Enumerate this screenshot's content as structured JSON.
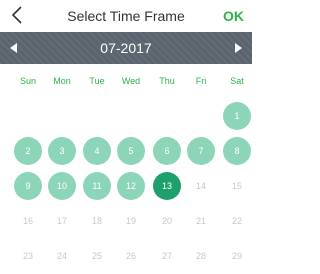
{
  "header": {
    "back_icon": "chevron-left-icon",
    "title": "Select Time Frame",
    "ok_label": "OK",
    "ok_color": "#2db34a"
  },
  "month_bar": {
    "label": "07-2017",
    "prev_icon": "triangle-left-icon",
    "next_icon": "triangle-right-icon",
    "background": "#5b646e"
  },
  "weekdays": [
    "Sun",
    "Mon",
    "Tue",
    "Wed",
    "Thu",
    "Fri",
    "Sat"
  ],
  "calendar": {
    "first_weekday_index": 6,
    "days": [
      {
        "label": "1",
        "state": "in-range"
      },
      {
        "label": "2",
        "state": "in-range"
      },
      {
        "label": "3",
        "state": "in-range"
      },
      {
        "label": "4",
        "state": "in-range"
      },
      {
        "label": "5",
        "state": "in-range"
      },
      {
        "label": "6",
        "state": "in-range"
      },
      {
        "label": "7",
        "state": "in-range"
      },
      {
        "label": "8",
        "state": "in-range"
      },
      {
        "label": "9",
        "state": "in-range"
      },
      {
        "label": "10",
        "state": "in-range"
      },
      {
        "label": "11",
        "state": "in-range"
      },
      {
        "label": "12",
        "state": "in-range"
      },
      {
        "label": "13",
        "state": "selected"
      },
      {
        "label": "14",
        "state": "disabled"
      },
      {
        "label": "15",
        "state": "disabled"
      },
      {
        "label": "16",
        "state": "disabled"
      },
      {
        "label": "17",
        "state": "disabled"
      },
      {
        "label": "18",
        "state": "disabled"
      },
      {
        "label": "19",
        "state": "disabled"
      },
      {
        "label": "20",
        "state": "disabled"
      },
      {
        "label": "21",
        "state": "disabled"
      },
      {
        "label": "22",
        "state": "disabled"
      },
      {
        "label": "23",
        "state": "disabled"
      },
      {
        "label": "24",
        "state": "disabled"
      },
      {
        "label": "25",
        "state": "disabled"
      },
      {
        "label": "26",
        "state": "disabled"
      },
      {
        "label": "27",
        "state": "disabled"
      },
      {
        "label": "28",
        "state": "disabled"
      },
      {
        "label": "29",
        "state": "disabled"
      }
    ],
    "colors": {
      "in_range": "#8cd5b8",
      "selected": "#1ea06d",
      "disabled_text": "#c8c8c8",
      "weekday_text": "#2db34a"
    }
  }
}
